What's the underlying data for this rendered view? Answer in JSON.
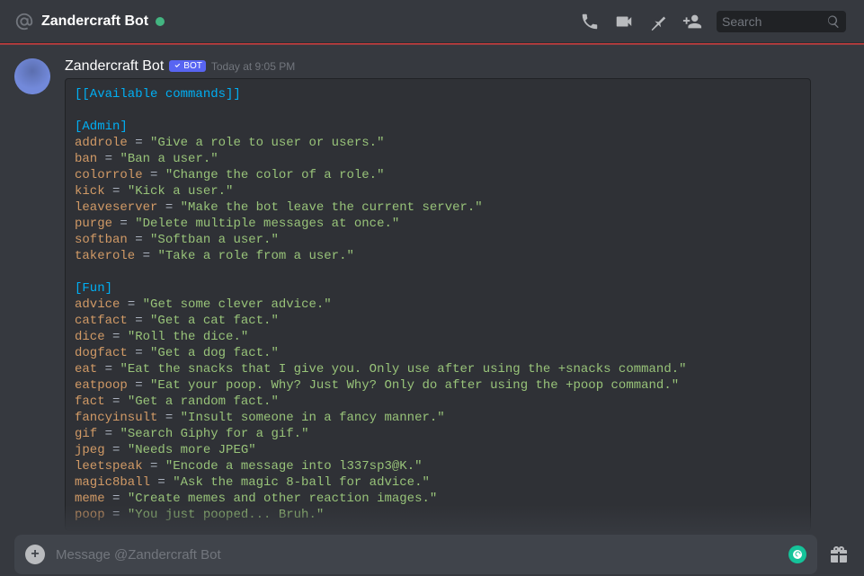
{
  "header": {
    "title": "Zandercraft Bot",
    "search_placeholder": "Search"
  },
  "message": {
    "author": "Zandercraft Bot",
    "bot_label": "BOT",
    "timestamp": "Today at 9:05 PM"
  },
  "code": {
    "title": "[[Available commands]]",
    "sections": [
      {
        "name": "[Admin]",
        "cmds": [
          {
            "k": "addrole",
            "v": "\"Give a role to user or users.\""
          },
          {
            "k": "ban",
            "v": "\"Ban a user.\""
          },
          {
            "k": "colorrole",
            "v": "\"Change the color of a role.\""
          },
          {
            "k": "kick",
            "v": "\"Kick a user.\""
          },
          {
            "k": "leaveserver",
            "v": "\"Make the bot leave the current server.\""
          },
          {
            "k": "purge",
            "v": "\"Delete multiple messages at once.\""
          },
          {
            "k": "softban",
            "v": "\"Softban a user.\""
          },
          {
            "k": "takerole",
            "v": "\"Take a role from a user.\""
          }
        ]
      },
      {
        "name": "[Fun]",
        "cmds": [
          {
            "k": "advice",
            "v": "\"Get some clever advice.\""
          },
          {
            "k": "catfact",
            "v": "\"Get a cat fact.\""
          },
          {
            "k": "dice",
            "v": "\"Roll the dice.\""
          },
          {
            "k": "dogfact",
            "v": "\"Get a dog fact.\""
          },
          {
            "k": "eat",
            "v": "\"Eat the snacks that I give you. Only use after using the +snacks command.\""
          },
          {
            "k": "eatpoop",
            "v": "\"Eat your poop. Why? Just Why? Only do after using the +poop command.\""
          },
          {
            "k": "fact",
            "v": "\"Get a random fact.\""
          },
          {
            "k": "fancyinsult",
            "v": "\"Insult someone in a fancy manner.\""
          },
          {
            "k": "gif",
            "v": "\"Search Giphy for a gif.\""
          },
          {
            "k": "jpeg",
            "v": "\"Needs more JPEG\""
          },
          {
            "k": "leetspeak",
            "v": "\"Encode a message into l337sp3@K.\""
          },
          {
            "k": "magic8ball",
            "v": "\"Ask the magic 8-ball for advice.\""
          },
          {
            "k": "meme",
            "v": "\"Create memes and other reaction images.\""
          },
          {
            "k": "poop",
            "v": "\"You just pooped... Bruh.\""
          }
        ]
      }
    ]
  },
  "input": {
    "placeholder": "Message @Zandercraft Bot"
  }
}
